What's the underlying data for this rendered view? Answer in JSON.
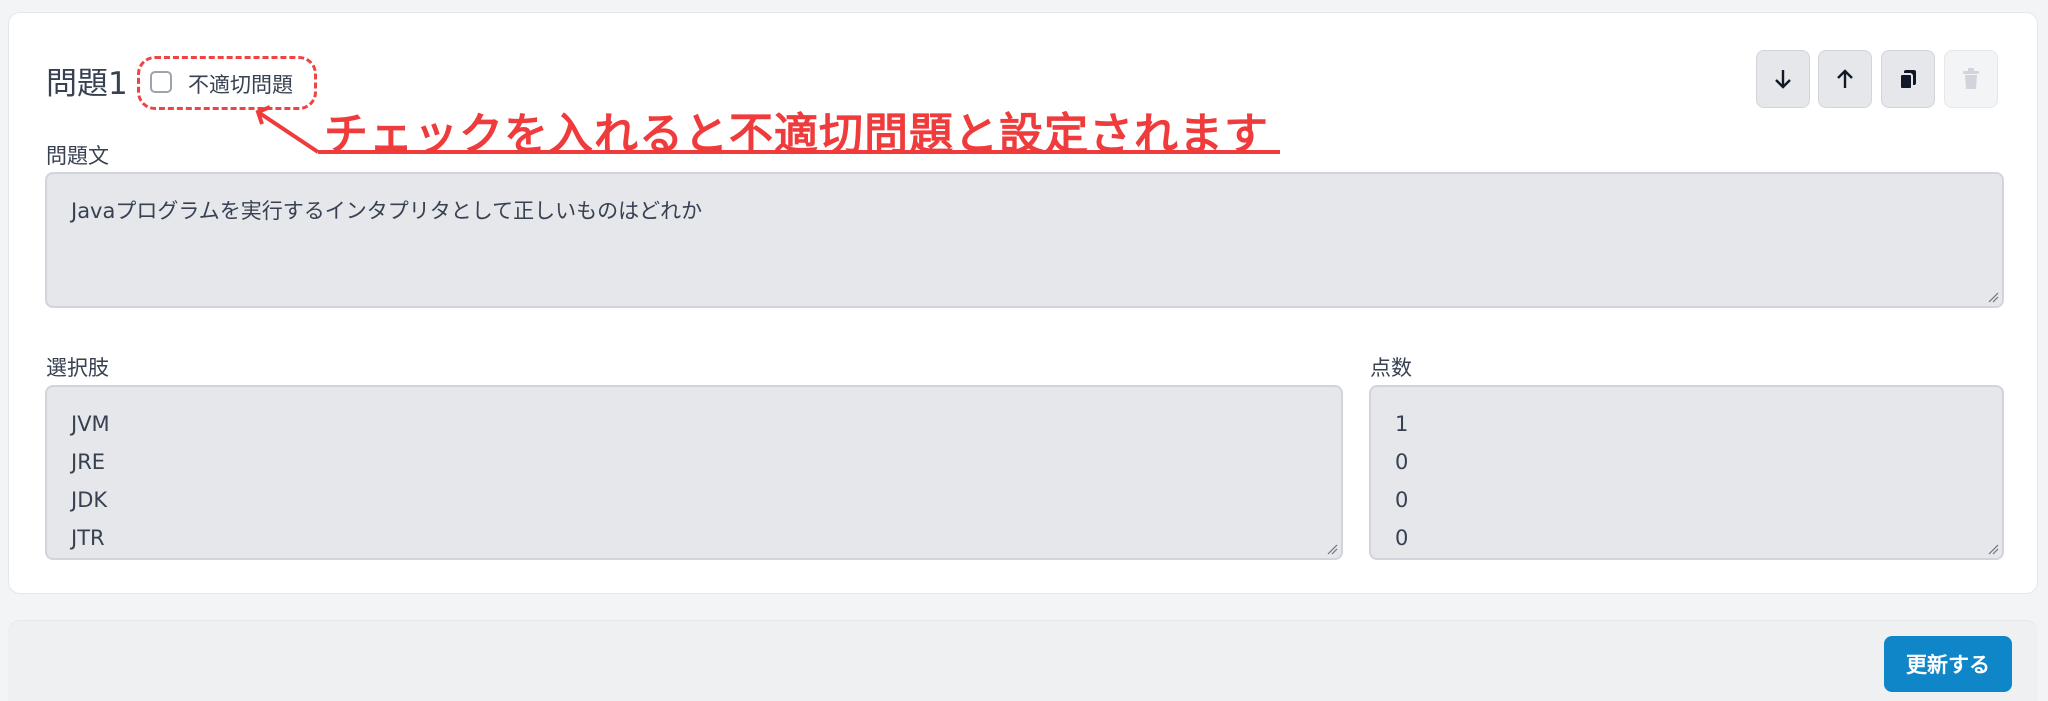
{
  "question": {
    "title": "問題1",
    "inappropriate_label": "不適切問題",
    "inappropriate_checked": false
  },
  "annotation": {
    "text": "チェックを入れると不適切問題と設定されます",
    "color": "#ef3b3b"
  },
  "toolbar": {
    "icons": [
      "arrow-down-icon",
      "arrow-up-icon",
      "copy-icon",
      "trash-icon"
    ]
  },
  "question_text": {
    "label": "問題文",
    "value": "Javaプログラムを実行するインタプリタとして正しいものはどれか"
  },
  "choices": {
    "label": "選択肢",
    "items": [
      "JVM",
      "JRE",
      "JDK",
      "JTR"
    ]
  },
  "scores": {
    "label": "点数",
    "items": [
      "1",
      "0",
      "0",
      "0"
    ]
  },
  "footer": {
    "update_label": "更新する",
    "accent": "#0f86c7"
  }
}
